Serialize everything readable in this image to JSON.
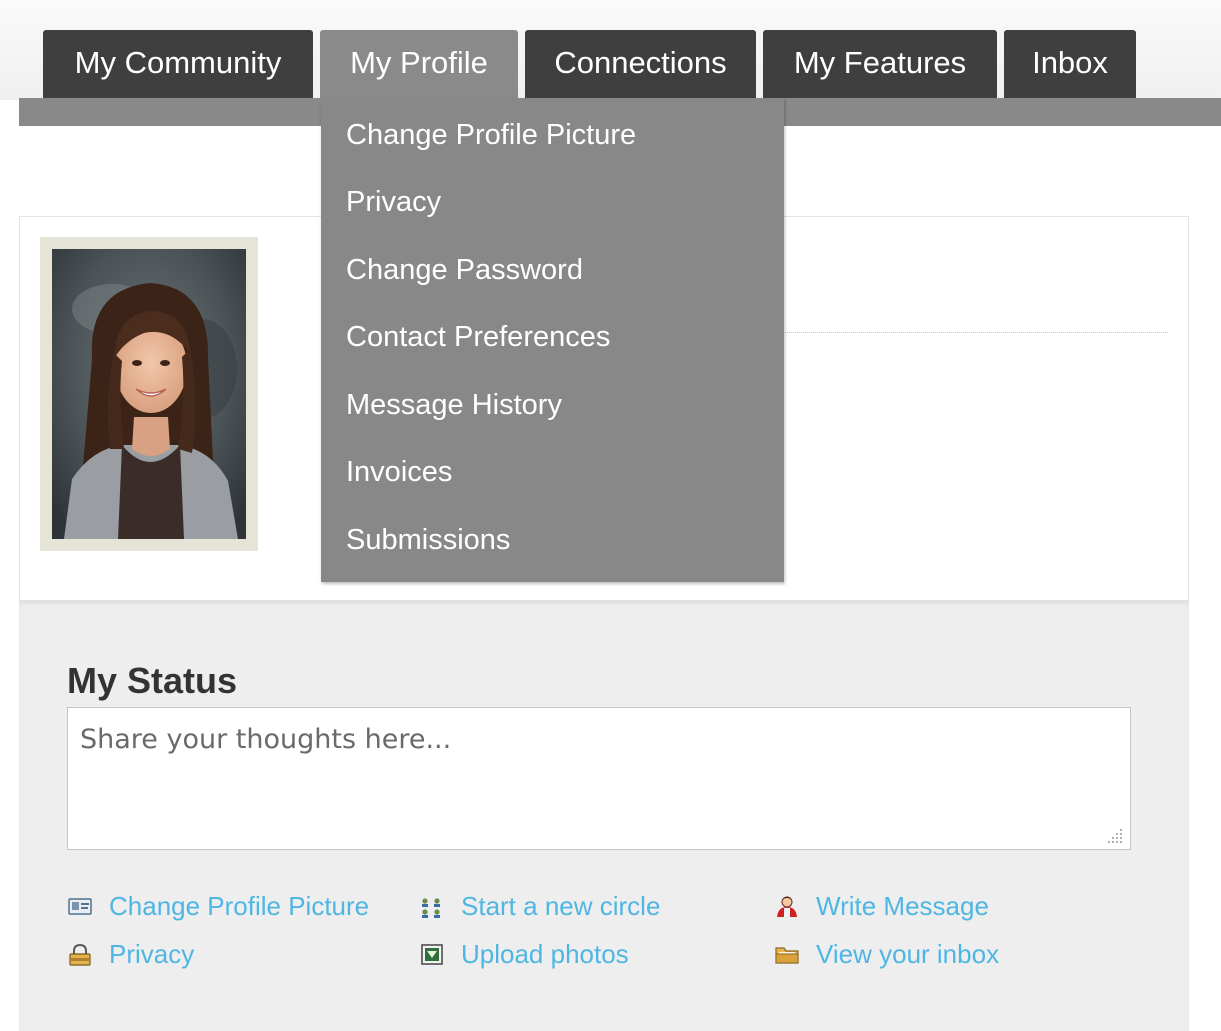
{
  "nav": {
    "tabs": [
      {
        "label": "My Community",
        "active": false
      },
      {
        "label": "My Profile",
        "active": true
      },
      {
        "label": "Connections",
        "active": false
      },
      {
        "label": "My Features",
        "active": false
      },
      {
        "label": "Inbox",
        "active": false
      }
    ]
  },
  "profile_menu": {
    "items": [
      "Change Profile Picture",
      "Privacy",
      "Change Password",
      "Contact Preferences",
      "Message History",
      "Invoices",
      "Submissions"
    ]
  },
  "status": {
    "title": "My Status",
    "placeholder": "Share your thoughts here..."
  },
  "quick_links": {
    "change_picture": {
      "label": "Change Profile Picture",
      "icon": "id-card-icon"
    },
    "privacy": {
      "label": "Privacy",
      "icon": "lock-icon"
    },
    "new_circle": {
      "label": "Start a new circle",
      "icon": "circle-dots-icon"
    },
    "upload_photos": {
      "label": "Upload photos",
      "icon": "photo-icon"
    },
    "write_message": {
      "label": "Write Message",
      "icon": "person-icon"
    },
    "view_inbox": {
      "label": "View your inbox",
      "icon": "folder-icon"
    }
  },
  "colors": {
    "tab": "#3f3f3f",
    "tab_active": "#8a8a8a",
    "menu": "#888888",
    "link": "#4fb6e4"
  }
}
